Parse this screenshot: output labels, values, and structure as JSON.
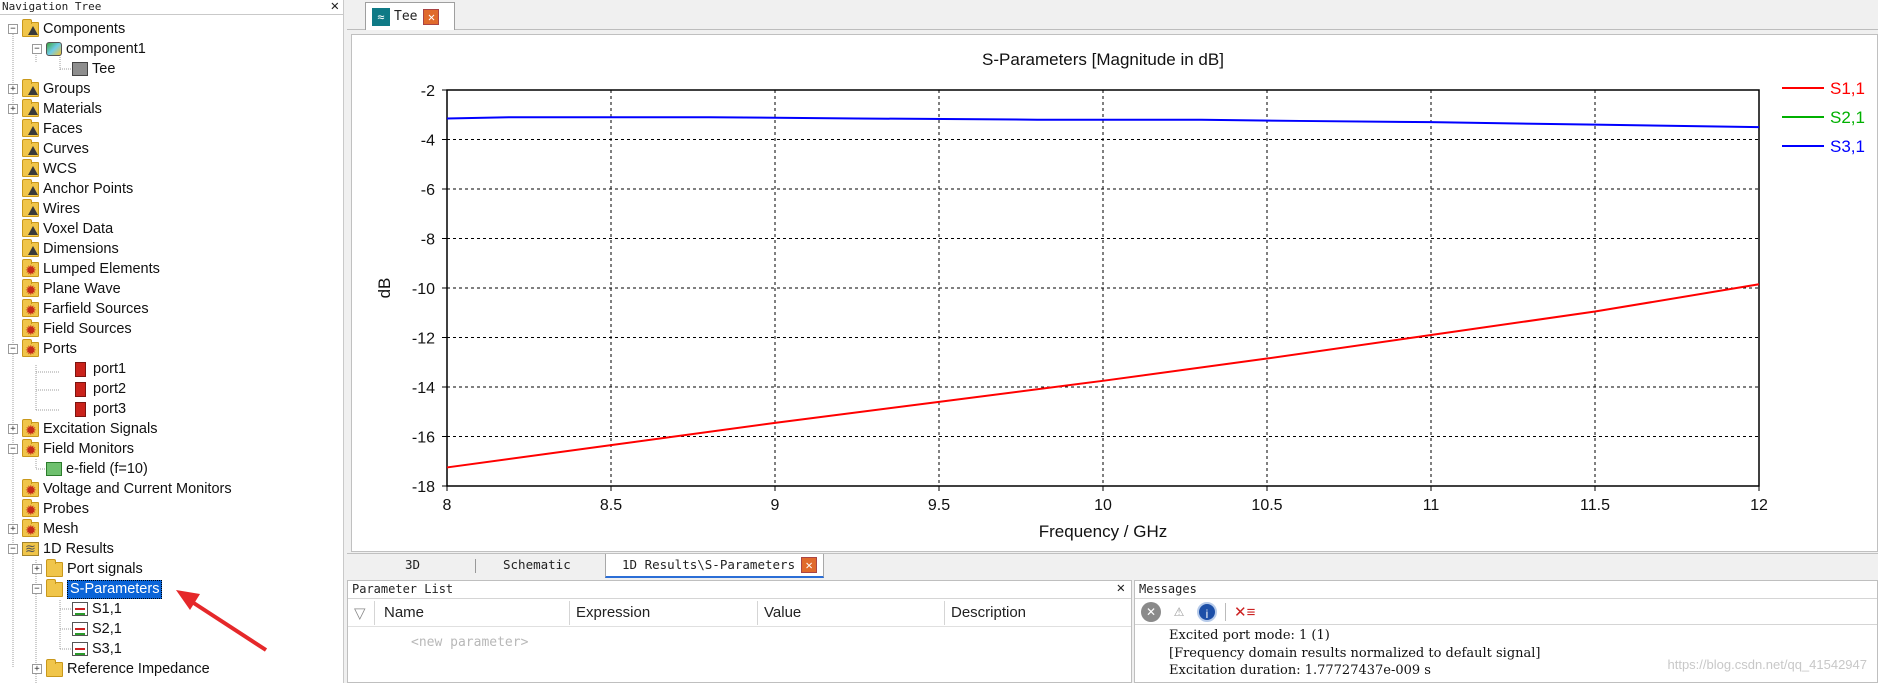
{
  "nav": {
    "title": "Navigation Tree",
    "close": "✕",
    "items": [
      {
        "label": "Components",
        "exp": "−",
        "icon": "folder-warn",
        "level": 0
      },
      {
        "label": "component1",
        "exp": "−",
        "icon": "component",
        "level": 1
      },
      {
        "label": "Tee",
        "exp": "",
        "icon": "solid",
        "level": 2
      },
      {
        "label": "Groups",
        "exp": "+",
        "icon": "folder-warn",
        "level": 0
      },
      {
        "label": "Materials",
        "exp": "+",
        "icon": "folder-warn",
        "level": 0
      },
      {
        "label": "Faces",
        "exp": "",
        "icon": "folder-warn",
        "level": 0
      },
      {
        "label": "Curves",
        "exp": "",
        "icon": "folder-warn",
        "level": 0
      },
      {
        "label": "WCS",
        "exp": "",
        "icon": "folder-warn",
        "level": 0
      },
      {
        "label": "Anchor Points",
        "exp": "",
        "icon": "folder-warn",
        "level": 0
      },
      {
        "label": "Wires",
        "exp": "",
        "icon": "folder-warn",
        "level": 0
      },
      {
        "label": "Voxel Data",
        "exp": "",
        "icon": "folder-warn",
        "level": 0
      },
      {
        "label": "Dimensions",
        "exp": "",
        "icon": "folder-warn",
        "level": 0
      },
      {
        "label": "Lumped Elements",
        "exp": "",
        "icon": "gear",
        "level": 0
      },
      {
        "label": "Plane Wave",
        "exp": "",
        "icon": "gear",
        "level": 0
      },
      {
        "label": "Farfield Sources",
        "exp": "",
        "icon": "gear",
        "level": 0
      },
      {
        "label": "Field Sources",
        "exp": "",
        "icon": "gear",
        "level": 0
      },
      {
        "label": "Ports",
        "exp": "−",
        "icon": "gear",
        "level": 0
      },
      {
        "label": "port1",
        "exp": "",
        "icon": "port",
        "level": 2
      },
      {
        "label": "port2",
        "exp": "",
        "icon": "port",
        "level": 2
      },
      {
        "label": "port3",
        "exp": "",
        "icon": "port",
        "level": 2
      },
      {
        "label": "Excitation Signals",
        "exp": "+",
        "icon": "gear",
        "level": 0
      },
      {
        "label": "Field Monitors",
        "exp": "−",
        "icon": "gear",
        "level": 0
      },
      {
        "label": "e-field (f=10)",
        "exp": "",
        "icon": "efield",
        "level": 1
      },
      {
        "label": "Voltage and Current Monitors",
        "exp": "",
        "icon": "gear",
        "level": 0
      },
      {
        "label": "Probes",
        "exp": "",
        "icon": "gear",
        "level": 0
      },
      {
        "label": "Mesh",
        "exp": "+",
        "icon": "gear",
        "level": 0
      },
      {
        "label": "1D Results",
        "exp": "−",
        "icon": "results",
        "level": 0
      },
      {
        "label": "Port signals",
        "exp": "+",
        "icon": "folder",
        "level": 1
      },
      {
        "label": "S-Parameters",
        "exp": "−",
        "icon": "folder",
        "level": 1,
        "selected": true
      },
      {
        "label": "S1,1",
        "exp": "",
        "icon": "graph",
        "level": 2
      },
      {
        "label": "S2,1",
        "exp": "",
        "icon": "graph",
        "level": 2
      },
      {
        "label": "S3,1",
        "exp": "",
        "icon": "graph",
        "level": 2
      },
      {
        "label": "Reference Impedance",
        "exp": "+",
        "icon": "folder",
        "level": 1
      }
    ]
  },
  "doc_tab": {
    "label": "Tee",
    "close": "✕"
  },
  "chart_data": {
    "type": "line",
    "title": "S-Parameters [Magnitude in dB]",
    "xlabel": "Frequency / GHz",
    "ylabel": "dB",
    "xlim": [
      8,
      12
    ],
    "ylim": [
      -18,
      -2
    ],
    "xticks": [
      8,
      8.5,
      9,
      9.5,
      10,
      10.5,
      11,
      11.5,
      12
    ],
    "yticks": [
      -2,
      -4,
      -6,
      -8,
      -10,
      -12,
      -14,
      -16,
      -18
    ],
    "grid": true,
    "legend_position": "top-right",
    "series": [
      {
        "name": "S1,1",
        "color": "#ff0000",
        "x": [
          8,
          8.5,
          9,
          9.5,
          10,
          10.5,
          11,
          11.5,
          12
        ],
        "y": [
          -17.25,
          -16.35,
          -15.45,
          -14.6,
          -13.75,
          -12.85,
          -11.9,
          -10.95,
          -9.85
        ]
      },
      {
        "name": "S2,1",
        "color": "#00b000",
        "x": [
          8,
          12
        ],
        "y": [
          -3.15,
          -3.5
        ]
      },
      {
        "name": "S3,1",
        "color": "#0000ff",
        "x": [
          8,
          8.2,
          8.8,
          9.25,
          9.8,
          10.3,
          10.6,
          11,
          11.5,
          12
        ],
        "y": [
          -3.15,
          -3.1,
          -3.1,
          -3.15,
          -3.2,
          -3.2,
          -3.25,
          -3.3,
          -3.4,
          -3.5
        ]
      }
    ]
  },
  "view_tabs": {
    "tab_3d": "3D",
    "tab_schematic": "Schematic",
    "tab_results": "1D Results\\S-Parameters",
    "close": "✕"
  },
  "param_list": {
    "title": "Parameter List",
    "close": "✕",
    "headers": [
      "Name",
      "Expression",
      "Value",
      "Description"
    ],
    "new_row": "<new parameter>"
  },
  "messages": {
    "title": "Messages",
    "lines": [
      "Excited port mode: 1 (1)",
      "[Frequency domain results normalized to default signal]",
      "Excitation duration: 1.77727437e-009 s"
    ],
    "watermark": "https://blog.csdn.net/qq_41542947"
  }
}
